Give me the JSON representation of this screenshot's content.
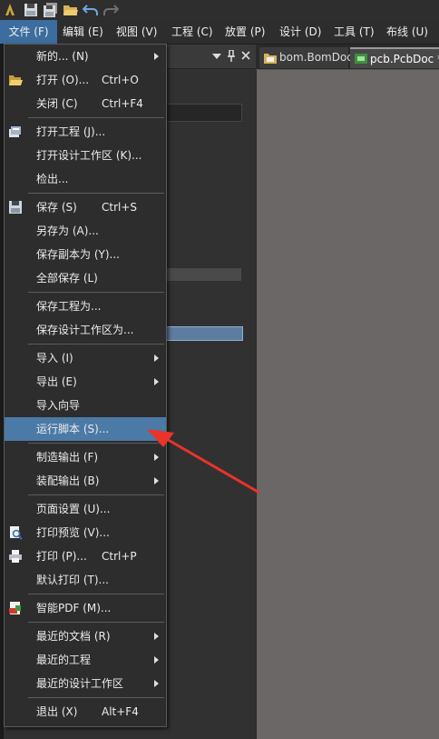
{
  "menubar": {
    "items": [
      {
        "label": "文件 (F)",
        "active": true
      },
      {
        "label": "编辑 (E)"
      },
      {
        "label": "视图 (V)"
      },
      {
        "label": "工程 (C)"
      },
      {
        "label": "放置 (P)"
      },
      {
        "label": "设计 (D)"
      },
      {
        "label": "工具 (T)"
      },
      {
        "label": "布线 (U)"
      }
    ]
  },
  "tabs": [
    {
      "label": "bom.BomDoc"
    },
    {
      "label": "pcb.PcbDoc *",
      "active": true
    }
  ],
  "file_menu": {
    "items": [
      {
        "label": "新的... (N)",
        "submenu": true
      },
      {
        "label": "打开 (O)...",
        "shortcut": "Ctrl+O",
        "icon": "folder-open-icon"
      },
      {
        "label": "关闭 (C)",
        "shortcut": "Ctrl+F4"
      },
      {
        "label": "打开工程 (J)...",
        "icon": "open-project-icon"
      },
      {
        "label": "打开设计工作区 (K)..."
      },
      {
        "label": "检出..."
      },
      {
        "label": "保存 (S)",
        "shortcut": "Ctrl+S",
        "icon": "save-icon"
      },
      {
        "label": "另存为 (A)..."
      },
      {
        "label": "保存副本为 (Y)..."
      },
      {
        "label": "全部保存 (L)"
      },
      {
        "label": "保存工程为..."
      },
      {
        "label": "保存设计工作区为..."
      },
      {
        "label": "导入 (I)",
        "submenu": true
      },
      {
        "label": "导出 (E)",
        "submenu": true
      },
      {
        "label": "导入向导"
      },
      {
        "label": "运行脚本 (S)...",
        "highlighted": true
      },
      {
        "label": "制造输出 (F)",
        "submenu": true
      },
      {
        "label": "装配输出 (B)",
        "submenu": true
      },
      {
        "label": "页面设置 (U)..."
      },
      {
        "label": "打印预览 (V)...",
        "icon": "print-preview-icon"
      },
      {
        "label": "打印 (P)...",
        "shortcut": "Ctrl+P",
        "icon": "printer-icon"
      },
      {
        "label": "默认打印 (T)..."
      },
      {
        "label": "智能PDF (M)...",
        "icon": "smart-pdf-icon"
      },
      {
        "label": "最近的文档 (R)",
        "submenu": true
      },
      {
        "label": "最近的工程",
        "submenu": true
      },
      {
        "label": "最近的设计工作区",
        "submenu": true
      },
      {
        "label": "退出 (X)",
        "shortcut": "Alt+F4"
      }
    ]
  },
  "colors": {
    "menu_bg": "#2d2d2d",
    "highlight": "#4c7aa6",
    "active_menu": "#3b6d9e",
    "workspace": "#6a6766",
    "annotation_arrow": "#e8342a"
  }
}
